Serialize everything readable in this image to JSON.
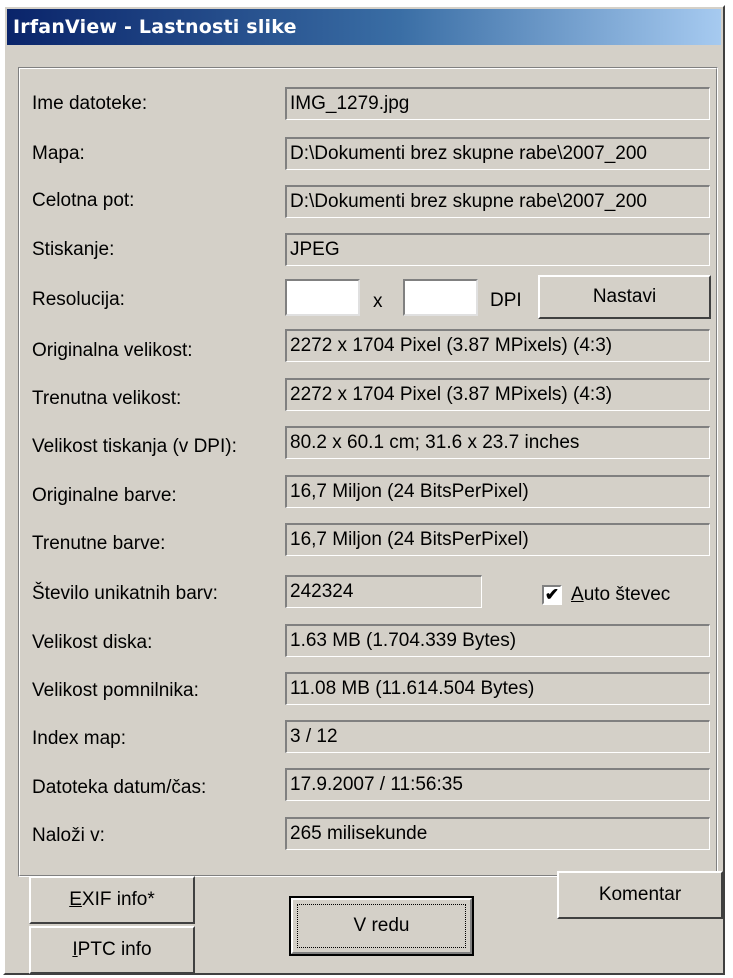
{
  "window": {
    "title": "IrfanView - Lastnosti slike"
  },
  "rows": [
    {
      "label": "Ime datoteke:",
      "value": "IMG_1279.jpg"
    },
    {
      "label": "Mapa:",
      "value": "D:\\Dokumenti brez skupne rabe\\2007_200"
    },
    {
      "label": "Celotna pot:",
      "value": "D:\\Dokumenti brez skupne rabe\\2007_200"
    },
    {
      "label": "Stiskanje:",
      "value": "JPEG"
    },
    {
      "label": "Resolucija:",
      "x_value": "",
      "y_value": "",
      "separator": "x",
      "unit": "DPI",
      "button": "Nastavi"
    },
    {
      "label": "Originalna velikost:",
      "value": "2272 x 1704  Pixel (3.87 MPixels) (4:3)"
    },
    {
      "label": "Trenutna velikost:",
      "value": "2272 x 1704  Pixel (3.87 MPixels) (4:3)"
    },
    {
      "label": "Velikost tiskanja (v DPI):",
      "value": "80.2 x 60.1 cm; 31.6 x 23.7 inches"
    },
    {
      "label": "Originalne barve:",
      "value": "16,7 Miljon   (24 BitsPerPixel)"
    },
    {
      "label": "Trenutne barve:",
      "value": "16,7 Miljon   (24 BitsPerPixel)"
    },
    {
      "label": "Število unikatnih barv:",
      "value": "242324",
      "checkbox_checked": true,
      "checkbox_mark": "✔",
      "checkbox_label_ul": "A",
      "checkbox_label_rest": "uto števec"
    },
    {
      "label": "Velikost diska:",
      "value": "1.63 MB (1.704.339 Bytes)"
    },
    {
      "label": "Velikost pomnilnika:",
      "value": "11.08  MB (11.614.504 Bytes)"
    },
    {
      "label": "Index map:",
      "value": "3  /  12"
    },
    {
      "label": "Datoteka datum/čas:",
      "value": "17.9.2007 / 11:56:35"
    },
    {
      "label": "Naloži v:",
      "value": "265 milisekunde"
    }
  ],
  "buttons": {
    "exif_ul": "E",
    "exif_rest": "XIF info*",
    "iptc_ul": "I",
    "iptc_rest": "PTC info",
    "ok": "V redu",
    "comment": "Komentar"
  }
}
